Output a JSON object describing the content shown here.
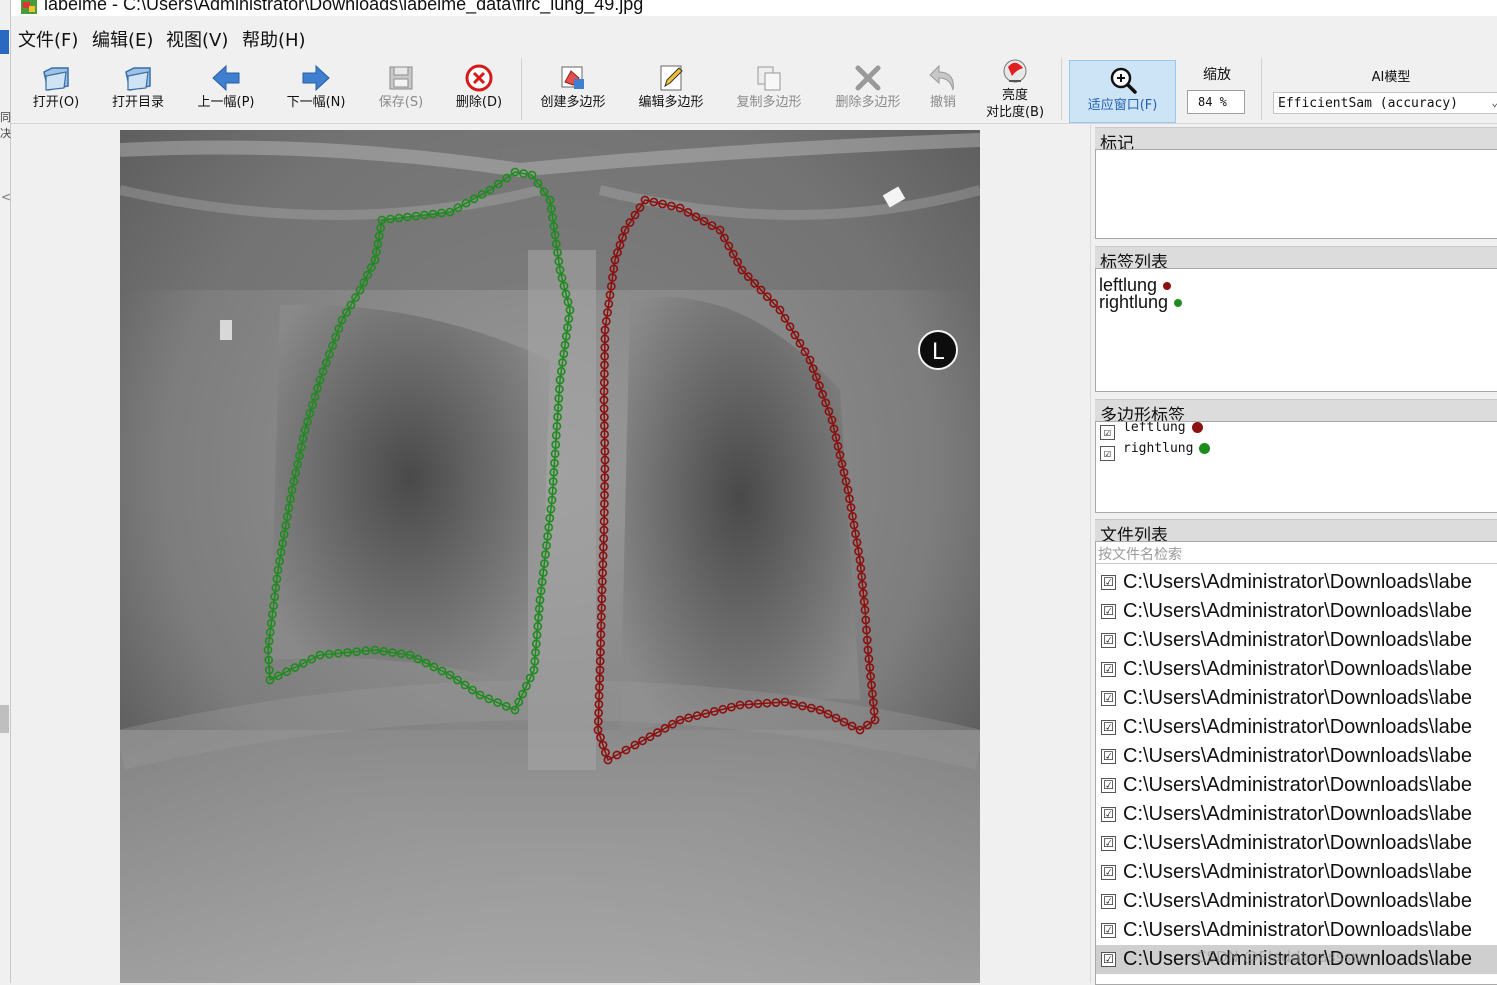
{
  "window": {
    "title": "labelme - C:\\Users\\Administrator\\Downloads\\labelme_data\\firc_lung_49.jpg"
  },
  "menu": [
    "文件(F)",
    "编辑(E)",
    "视图(V)",
    "帮助(H)"
  ],
  "toolbar": {
    "open": "打开(O)",
    "open_dir": "打开目录",
    "prev": "上一幅(P)",
    "next": "下一幅(N)",
    "save": "保存(S)",
    "delete_file": "删除(D)",
    "create_polygon": "创建多边形",
    "edit_polygon": "编辑多边形",
    "copy_polygon": "复制多边形",
    "delete_polygon": "删除多边形",
    "undo": "撤销",
    "brightness_line1": "亮度",
    "brightness_line2": "对比度(B)",
    "fit_window": "适应窗口(F)",
    "zoom_label": "缩放",
    "zoom_value": "84 %",
    "ai_label": "AI模型",
    "ai_model": "EfficientSam (accuracy)"
  },
  "canvas": {
    "image_marker": "L",
    "shapes": [
      {
        "label": "rightlung",
        "color": "#1f8b1f"
      },
      {
        "label": "leftlung",
        "color": "#8b1010"
      }
    ]
  },
  "left_strip": {
    "glyph1": "同",
    "glyph2": "决",
    "arrow": "<"
  },
  "docks": {
    "flags": {
      "title": "标记"
    },
    "label_list": {
      "title": "标签列表",
      "items": [
        {
          "label": "leftlung",
          "color": "#8b1010"
        },
        {
          "label": "rightlung",
          "color": "#1f8b1f"
        }
      ]
    },
    "polygon_labels": {
      "title": "多边形标签",
      "items": [
        {
          "label": "leftlung",
          "checked": "☑",
          "color": "#8b1010"
        },
        {
          "label": "rightlung",
          "checked": "☑",
          "color": "#1f8b1f"
        }
      ]
    },
    "file_list": {
      "title": "文件列表",
      "search_placeholder": "按文件名检索",
      "items": [
        "C:\\Users\\Administrator\\Downloads\\labe",
        "C:\\Users\\Administrator\\Downloads\\labe",
        "C:\\Users\\Administrator\\Downloads\\labe",
        "C:\\Users\\Administrator\\Downloads\\labe",
        "C:\\Users\\Administrator\\Downloads\\labe",
        "C:\\Users\\Administrator\\Downloads\\labe",
        "C:\\Users\\Administrator\\Downloads\\labe",
        "C:\\Users\\Administrator\\Downloads\\labe",
        "C:\\Users\\Administrator\\Downloads\\labe",
        "C:\\Users\\Administrator\\Downloads\\labe",
        "C:\\Users\\Administrator\\Downloads\\labe",
        "C:\\Users\\Administrator\\Downloads\\labe",
        "C:\\Users\\Administrator\\Downloads\\labe",
        "C:\\Users\\Administrator\\Downloads\\labe"
      ]
    }
  },
  "watermark": "CSDN @Eladdaaassssa"
}
